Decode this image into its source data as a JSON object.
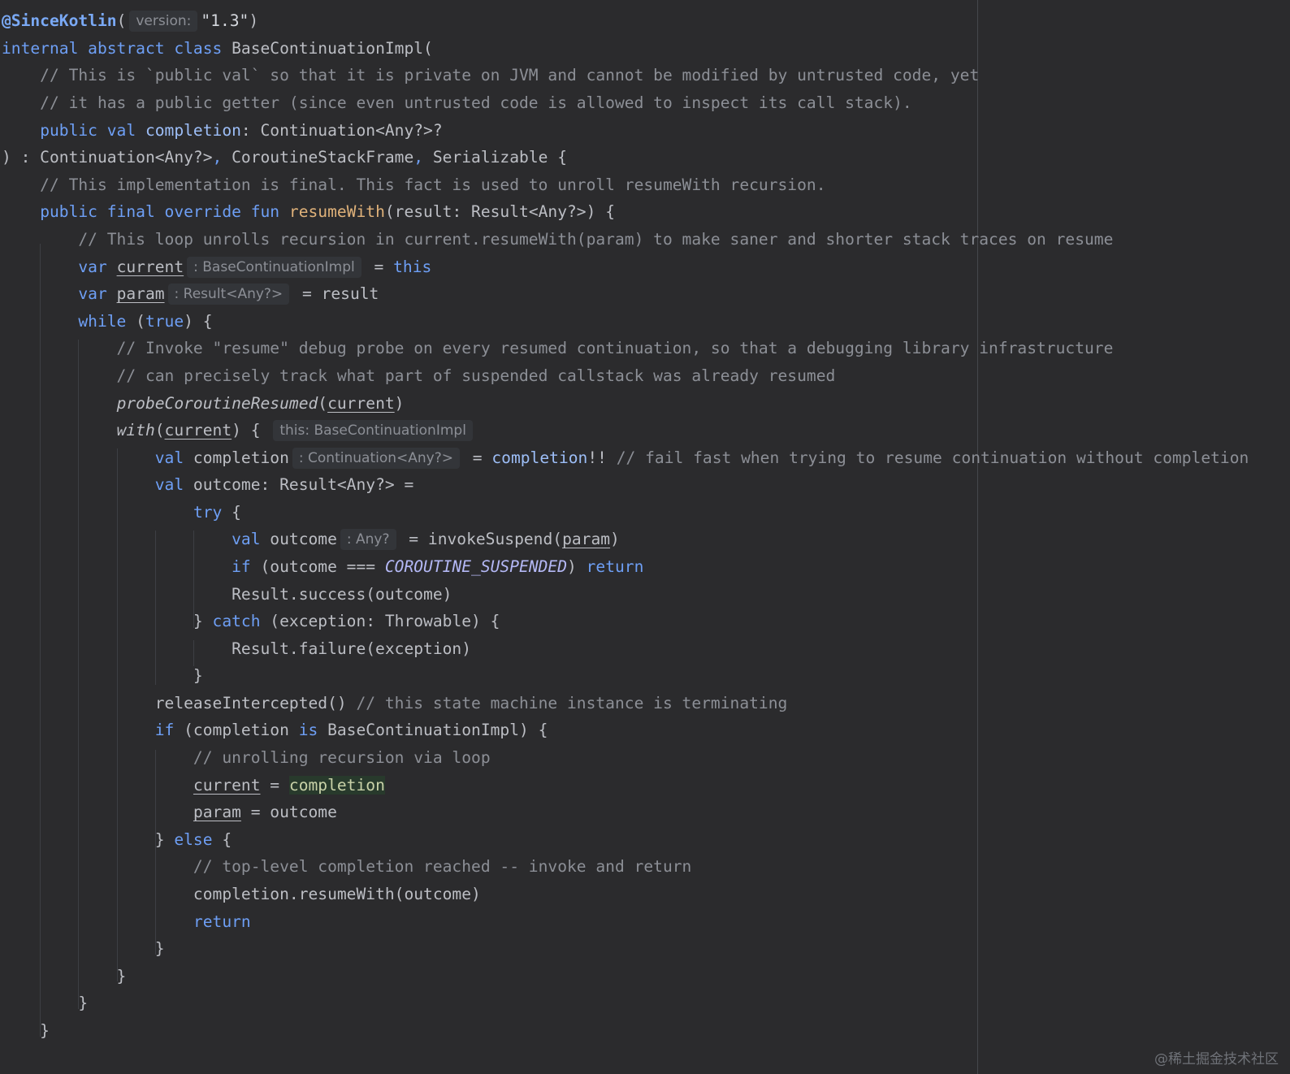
{
  "code": {
    "l1_anno": "@SinceKotlin",
    "l1_paren_open": "(",
    "l1_hint": "version:",
    "l1_str": "\"1.3\"",
    "l1_paren_close": ")",
    "l2_kw": "internal abstract class",
    "l2_rest": " BaseContinuationImpl(",
    "l3": "    // This is `public val` so that it is private on JVM and cannot be modified by untrusted code, yet",
    "l4": "    // it has a public getter (since even untrusted code is allowed to inspect its call stack).",
    "l5_indent": "    ",
    "l5_kw": "public val",
    "l5_prop": "completion",
    "l5_rest": ": Continuation<Any?>?",
    "l6_a": ") : Continuation<Any?>",
    "l6_c1": ",",
    "l6_b": " CoroutineStackFrame",
    "l6_c2": ",",
    "l6_c": " Serializable {",
    "l7": "    // This implementation is final. This fact is used to unroll resumeWith recursion.",
    "l8_indent": "    ",
    "l8_kw": "public final override fun",
    "l8_fn": "resumeWith",
    "l8_rest": "(result: Result<Any?>) {",
    "l9": "        // This loop unrolls recursion in current.resumeWith(param) to make saner and shorter stack traces on resume",
    "l10_indent": "        ",
    "l10_kw": "var",
    "l10_var": "current",
    "l10_hint": ": BaseContinuationImpl",
    "l10_eq": " = ",
    "l10_this": "this",
    "l11_indent": "        ",
    "l11_kw": "var",
    "l11_var": "param",
    "l11_hint": ": Result<Any?>",
    "l11_rest": " = result",
    "l12_indent": "        ",
    "l12_kw": "while",
    "l12_a": " (",
    "l12_true": "true",
    "l12_b": ") {",
    "l13": "            // Invoke \"resume\" debug probe on every resumed continuation, so that a debugging library infrastructure",
    "l14": "            // can precisely track what part of suspended callstack was already resumed",
    "l15_indent": "            ",
    "l15_fn": "probeCoroutineResumed",
    "l15_a": "(",
    "l15_var": "current",
    "l15_b": ")",
    "l16_indent": "            ",
    "l16_fn": "with",
    "l16_a": "(",
    "l16_var": "current",
    "l16_b": ") { ",
    "l16_hint": "this: BaseContinuationImpl",
    "l17_indent": "                ",
    "l17_kw": "val",
    "l17_name": " completion",
    "l17_hint": ": Continuation<Any?>",
    "l17_eq": " = ",
    "l17_prop": "completion",
    "l17_bang": "!! ",
    "l17_cm": "// fail fast when trying to resume continuation without completion",
    "l18_indent": "                ",
    "l18_kw": "val",
    "l18_rest": " outcome: Result<Any?> =",
    "l19_indent": "                    ",
    "l19_kw": "try",
    "l19_rest": " {",
    "l20_indent": "                        ",
    "l20_kw": "val",
    "l20_name": " outcome",
    "l20_hint": ": Any?",
    "l20_a": " = invokeSuspend(",
    "l20_var": "param",
    "l20_b": ")",
    "l21_indent": "                        ",
    "l21_kw": "if",
    "l21_a": " (outcome === ",
    "l21_const": "COROUTINE_SUSPENDED",
    "l21_b": ") ",
    "l21_ret": "return",
    "l22": "                        Result.success(outcome)",
    "l23_a": "                    } ",
    "l23_kw": "catch",
    "l23_b": " (exception: Throwable) {",
    "l24": "                        Result.failure(exception)",
    "l25": "                    }",
    "l26_a": "                releaseIntercepted() ",
    "l26_cm": "// this state machine instance is terminating",
    "l27_indent": "                ",
    "l27_kw": "if",
    "l27_a": " (completion ",
    "l27_is": "is",
    "l27_b": " BaseContinuationImpl) {",
    "l28": "                    // unrolling recursion via loop",
    "l29_indent": "                    ",
    "l29_var": "current",
    "l29_eq": " = ",
    "l29_hl": "completion",
    "l30_indent": "                    ",
    "l30_var": "param",
    "l30_rest": " = outcome",
    "l31_a": "                } ",
    "l31_kw": "else",
    "l31_b": " {",
    "l32": "                    // top-level completion reached -- invoke and return",
    "l33": "                    completion.resumeWith(outcome)",
    "l34_indent": "                    ",
    "l34_kw": "return",
    "l35": "                }",
    "l36": "            }",
    "l37": "        }",
    "l38": "    }"
  },
  "watermark": "@稀土掘金技术社区",
  "colors": {
    "background": "#2b2b2d",
    "keyword": "#6e9ff5",
    "function": "#e0b27a",
    "comment": "#8c8f96",
    "text": "#bcbec4"
  }
}
